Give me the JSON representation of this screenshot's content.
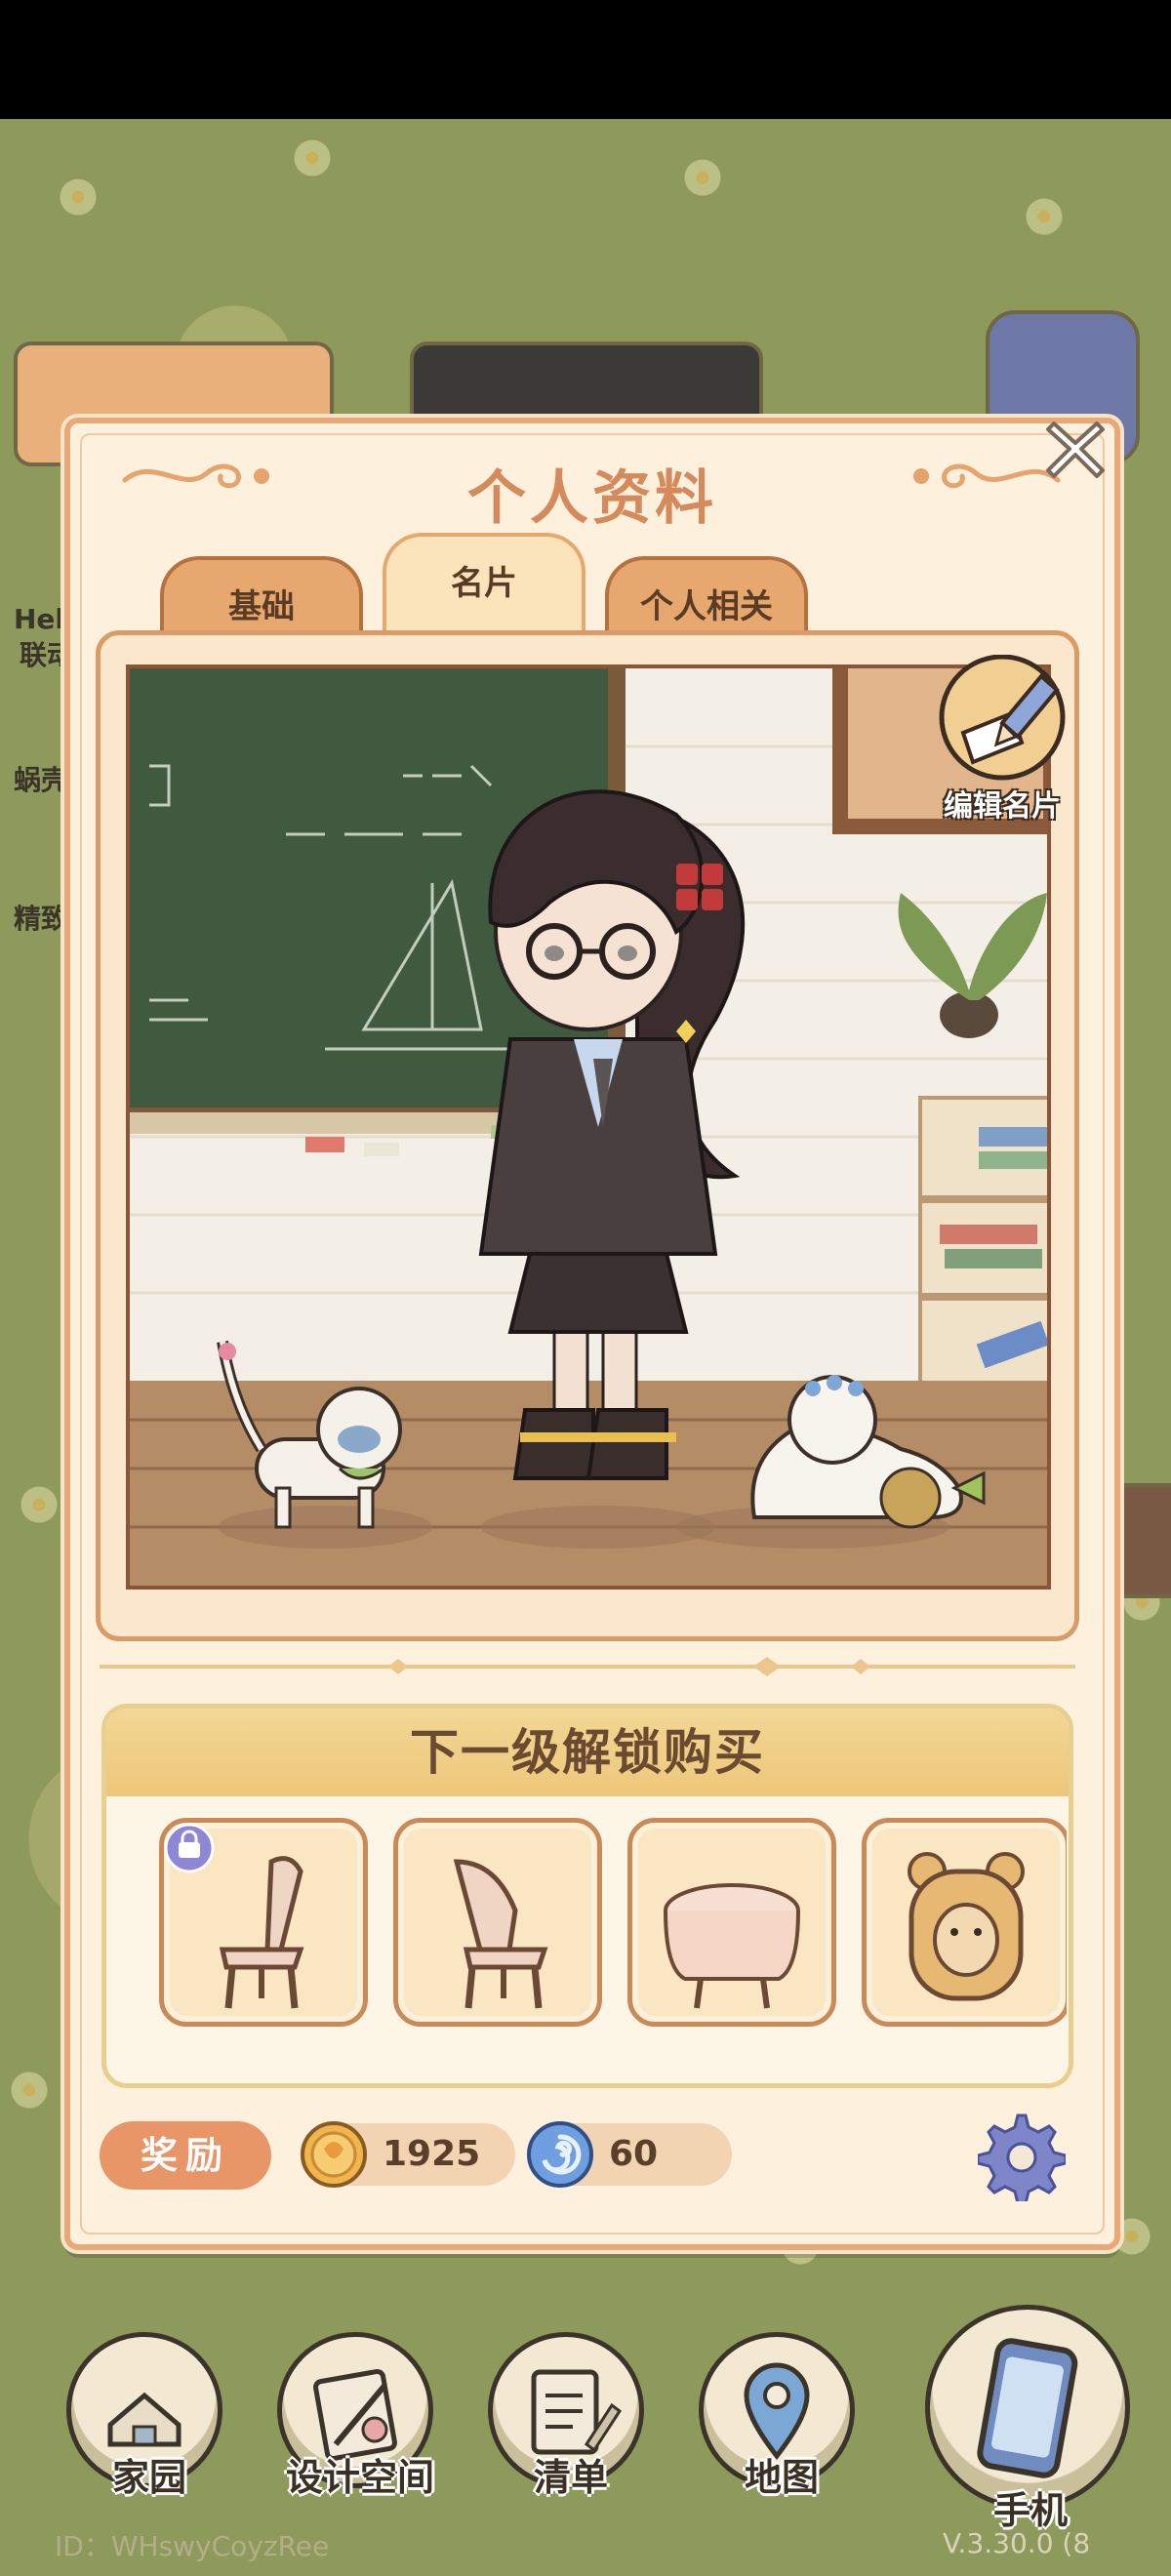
{
  "panel": {
    "title": "个人资料",
    "tabs": [
      {
        "label": "基础",
        "active": false
      },
      {
        "label": "名片",
        "active": true
      },
      {
        "label": "个人相关",
        "active": false
      }
    ],
    "edit_card_label": "编辑名片",
    "unlock_title": "下一级解锁购买",
    "unlock_items": [
      {
        "icon": "chair-icon",
        "locked_badge": true
      },
      {
        "icon": "chair-back-icon",
        "locked_badge": false
      },
      {
        "icon": "round-table-icon",
        "locked_badge": false
      },
      {
        "icon": "bear-backpack-icon",
        "locked_badge": false
      }
    ],
    "reward_label": "奖励",
    "currencies": [
      {
        "icon": "gold-coin-icon",
        "value": "1925"
      },
      {
        "icon": "blue-swirl-gem-icon",
        "value": "60"
      }
    ]
  },
  "side_icons": {
    "left": [
      "Hel",
      "联动",
      "蜗壳",
      "精致"
    ]
  },
  "bottom_nav": [
    {
      "label": "家园",
      "icon": "house-icon"
    },
    {
      "label": "设计空间",
      "icon": "design-icon"
    },
    {
      "label": "清单",
      "icon": "list-icon"
    },
    {
      "label": "地图",
      "icon": "map-pin-icon"
    },
    {
      "label": "手机",
      "icon": "phone-icon"
    }
  ],
  "footer": {
    "player_id": "ID：WHswyCoyzRee",
    "version": "V.3.30.0 (8"
  },
  "colors": {
    "panel_bg": "#fdf0dc",
    "panel_border": "#e7a978",
    "title": "#d48a5a",
    "tab_inactive": "#e6a86e",
    "tab_active": "#fbe4bb",
    "reward_button": "#e89667",
    "settings": "#7e86c9"
  }
}
